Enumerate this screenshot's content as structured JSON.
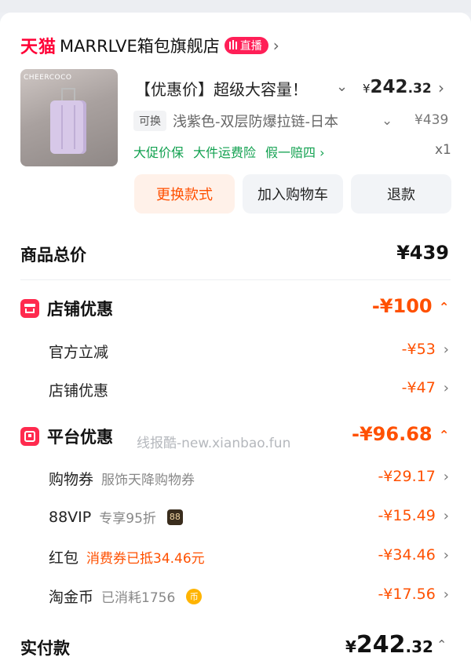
{
  "store": {
    "platform": "天猫",
    "name": "MARRLVE箱包旗舰店",
    "live_badge": "直播",
    "chevron": "›"
  },
  "product": {
    "thumb_brand": "CHEERCOCO",
    "title": "【优惠价】超级大容量！",
    "price_symbol": "¥",
    "price_int": "242",
    "price_dec": ".32",
    "exchange_tag": "可换",
    "spec": "浅紫色-双层防爆拉链-日本",
    "original_price": "¥439",
    "tags": [
      "大促价保",
      "大件运费险",
      "假一赔四 ›"
    ],
    "quantity": "x1"
  },
  "buttons": {
    "change_style": "更换款式",
    "add_cart": "加入购物车",
    "refund": "退款"
  },
  "total": {
    "label": "商品总价",
    "value": "¥439"
  },
  "store_discount": {
    "label": "店铺优惠",
    "value": "-¥100",
    "items": [
      {
        "label": "官方立减",
        "value": "-¥53"
      },
      {
        "label": "店铺优惠",
        "value": "-¥47"
      }
    ]
  },
  "platform_discount": {
    "label": "平台优惠",
    "value": "-¥96.68",
    "items": [
      {
        "label": "购物券",
        "note": "服饰天降购物券",
        "value": "-¥29.17"
      },
      {
        "label": "88VIP",
        "note": "专享95折",
        "badge": "88",
        "value": "-¥15.49"
      },
      {
        "label": "红包",
        "note": "消费券已抵34.46元",
        "value": "-¥34.46"
      },
      {
        "label": "淘金币",
        "note": "已消耗1756",
        "badge": "币",
        "value": "-¥17.56"
      }
    ]
  },
  "watermark": "线报酷-new.xianbao.fun",
  "payment": {
    "label": "实付款",
    "symbol": "¥",
    "int": "242",
    "dec": ".32"
  },
  "icons": {
    "chevron": "›",
    "expand": "⌄"
  },
  "colors": {
    "accent": "#ff5000",
    "tmall_red": "#ff0036",
    "green": "#12a150"
  }
}
